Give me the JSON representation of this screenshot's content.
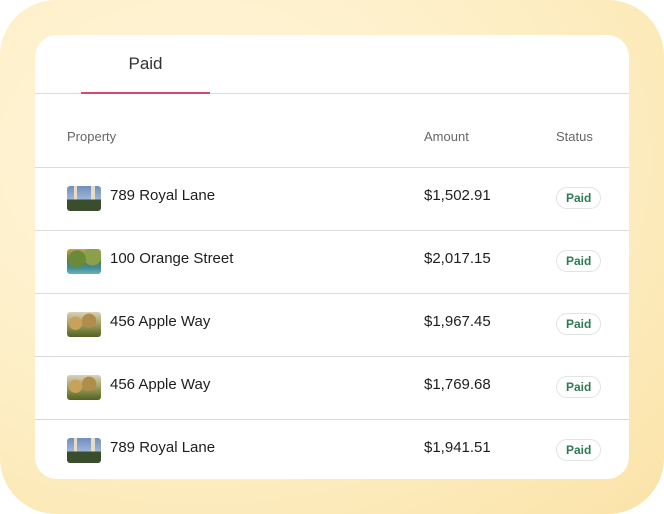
{
  "tabs": [
    {
      "label": "Paid"
    }
  ],
  "table": {
    "headers": {
      "property": "Property",
      "amount": "Amount",
      "status": "Status"
    },
    "rows": [
      {
        "image": "castle-photo",
        "property": "789 Royal Lane",
        "amount": "$1,502.91",
        "status": "Paid"
      },
      {
        "image": "garden-pond-photo",
        "property": "100 Orange Street",
        "amount": "$2,017.15",
        "status": "Paid"
      },
      {
        "image": "orchard-photo",
        "property": "456 Apple Way",
        "amount": "$1,967.45",
        "status": "Paid"
      },
      {
        "image": "orchard-photo",
        "property": "456 Apple Way",
        "amount": "$1,769.68",
        "status": "Paid"
      },
      {
        "image": "castle-photo",
        "property": "789 Royal Lane",
        "amount": "$1,941.51",
        "status": "Paid"
      }
    ]
  },
  "colors": {
    "tab_underline": "#d9476a",
    "status_text": "#2e7a52",
    "frame_background": "#fdeec4"
  }
}
